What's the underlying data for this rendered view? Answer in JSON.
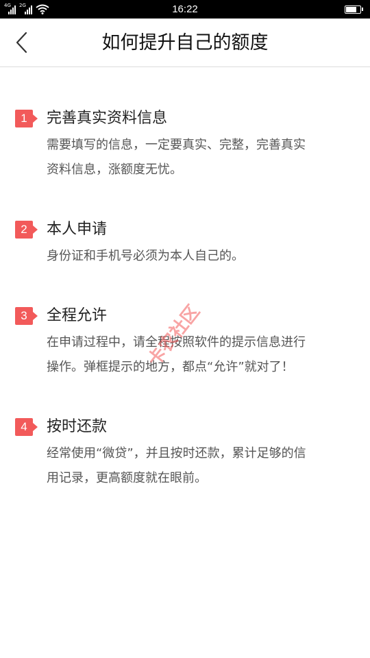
{
  "status_bar": {
    "network_1": "4G",
    "network_2": "2G",
    "time": "16:22",
    "battery_level": 0.75
  },
  "nav": {
    "back_icon": "chevron-left-icon",
    "title": "如何提升自己的额度"
  },
  "steps": [
    {
      "number": "1",
      "title": "完善真实资料信息",
      "desc_lines": [
        "需要填写的信息，一定要真实、完整，完善真实",
        "资料信息，涨额度无忧。"
      ]
    },
    {
      "number": "2",
      "title": "本人申请",
      "desc_lines": [
        "身份证和手机号必须为本人自己的。"
      ]
    },
    {
      "number": "3",
      "title": "全程允许",
      "desc_lines": [
        "在申请过程中，请全程按照软件的提示信息进行",
        "操作。弹框提示的地方，都点“允许”就对了！"
      ]
    },
    {
      "number": "4",
      "title": "按时还款",
      "desc_lines": [
        "经常使用“微贷”，并且按时还款，累计足够的信",
        "用记录，更高额度就在眼前。"
      ]
    }
  ],
  "watermark": "卡农社区",
  "colors": {
    "accent": "#f25a5a",
    "status_bar_bg": "#000000",
    "divider": "#dcdcdc",
    "body_text": "#555555"
  }
}
